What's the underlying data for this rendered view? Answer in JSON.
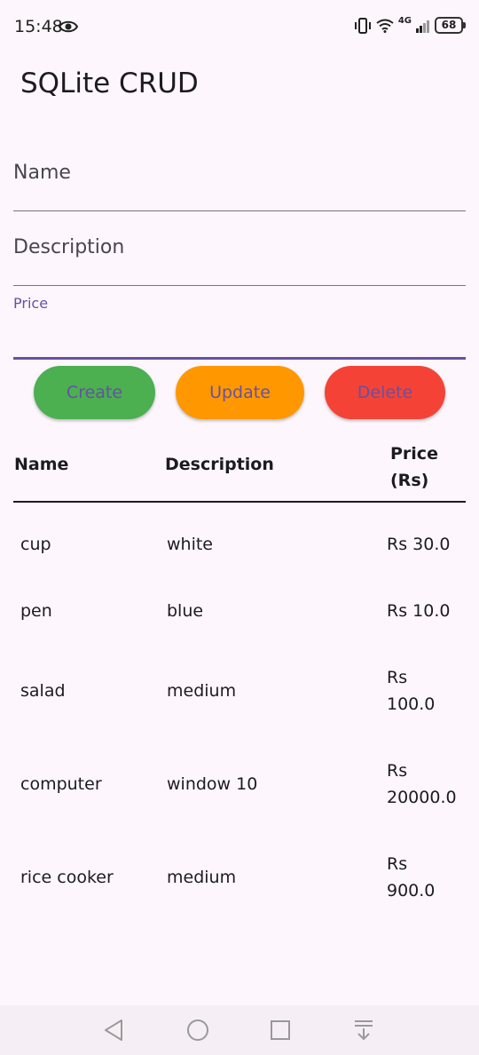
{
  "status": {
    "time": "15:48",
    "network": "4G",
    "battery": "68"
  },
  "app": {
    "title": "SQLite CRUD"
  },
  "form": {
    "name_label": "Name",
    "description_label": "Description",
    "price_label": "Price"
  },
  "buttons": {
    "create": "Create",
    "update": "Update",
    "delete": "Delete"
  },
  "table": {
    "headers": {
      "name": "Name",
      "description": "Description",
      "price_line1": "Price",
      "price_line2": "(Rs)"
    },
    "rows": [
      {
        "name": "cup",
        "description": "white",
        "price": "Rs 30.0"
      },
      {
        "name": "pen",
        "description": "blue",
        "price": "Rs 10.0"
      },
      {
        "name": "salad",
        "description": "medium",
        "price_line1": "Rs",
        "price_line2": "100.0"
      },
      {
        "name": "computer",
        "description": "window 10",
        "price_line1": "Rs",
        "price_line2": "20000.0"
      },
      {
        "name": "rice cooker",
        "description": "medium",
        "price_line1": "Rs",
        "price_line2": "900.0"
      }
    ]
  },
  "colors": {
    "create": "#4caf50",
    "update": "#ff9800",
    "delete": "#f44336",
    "accent": "#6750a4"
  },
  "nav": {
    "icons": [
      "back-icon",
      "home-icon",
      "recents-icon",
      "notification-pull-icon"
    ]
  }
}
